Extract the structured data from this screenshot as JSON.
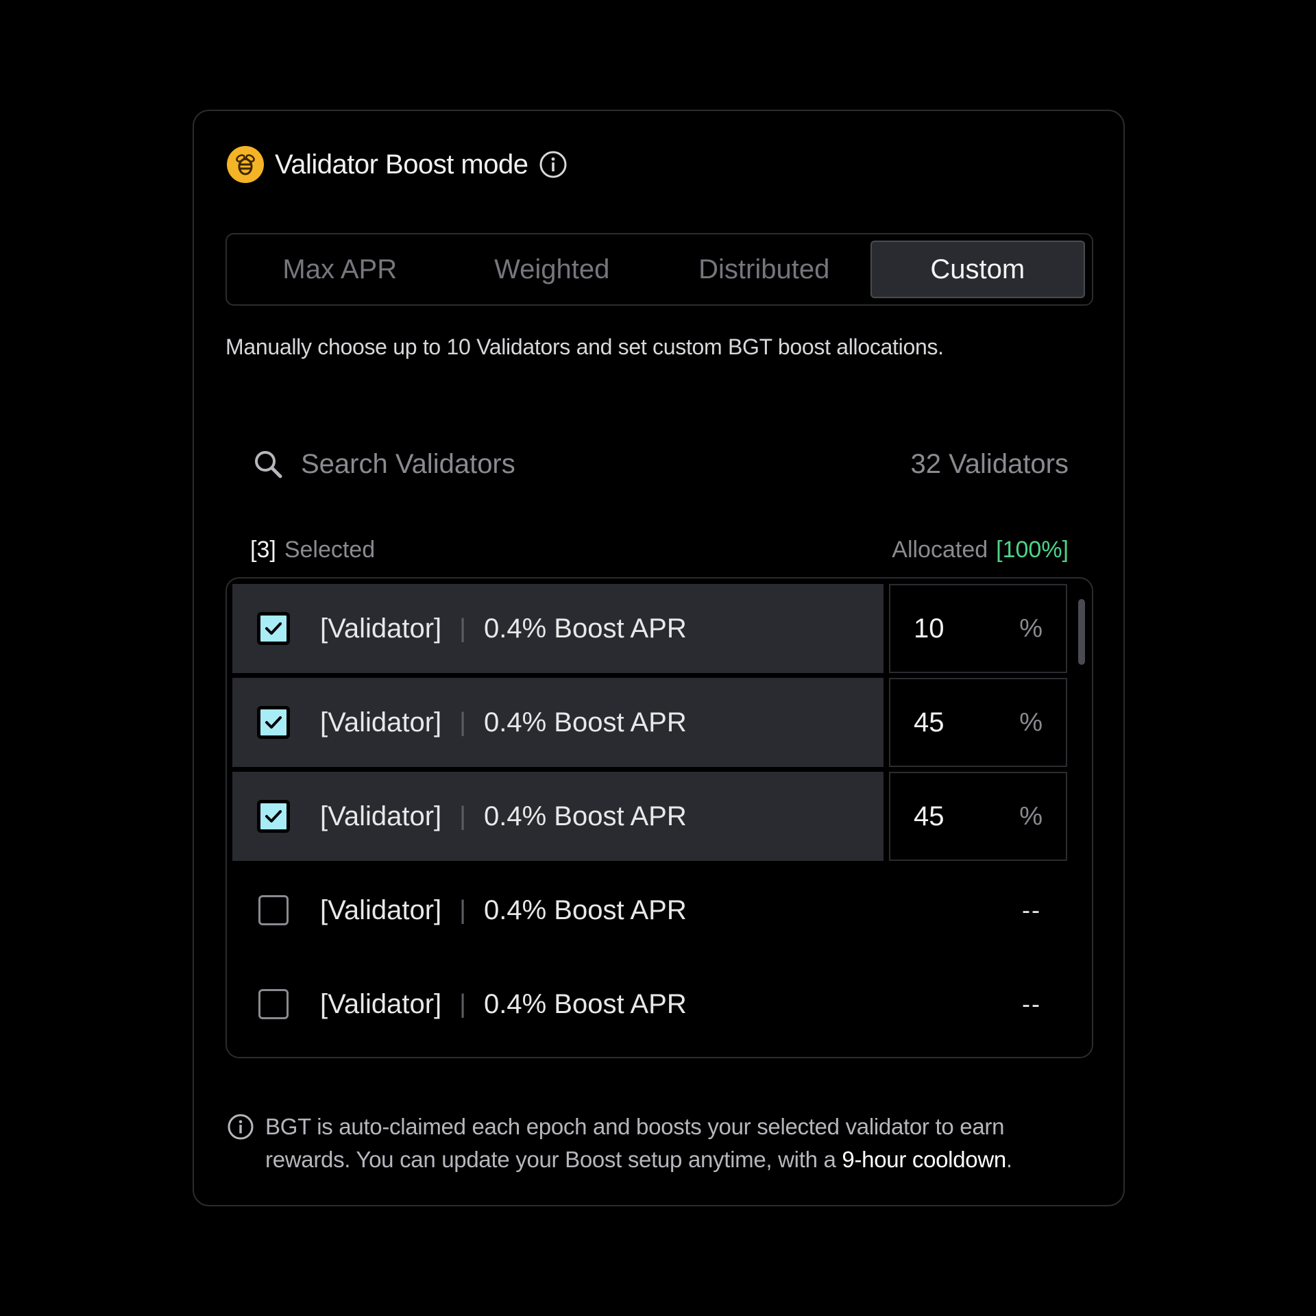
{
  "header": {
    "title": "Validator Boost mode",
    "logo_icon": "bee-logo-icon",
    "info_icon": "info-icon",
    "logo_color": "#f5b425"
  },
  "tabs": [
    {
      "label": "Max APR",
      "active": false
    },
    {
      "label": "Weighted",
      "active": false
    },
    {
      "label": "Distributed",
      "active": false
    },
    {
      "label": "Custom",
      "active": true
    }
  ],
  "description": "Manually choose up to 10 Validators and set custom BGT boost allocations.",
  "search": {
    "placeholder": "Search Validators",
    "value": "",
    "count_label": "32 Validators"
  },
  "summary": {
    "selected_count": "[3]",
    "selected_label": "Selected",
    "allocated_label": "Allocated",
    "allocated_value": "[100%]",
    "allocated_color": "#4ed48a"
  },
  "validators": [
    {
      "name": "[Validator]",
      "separator": "|",
      "apr": "0.4% Boost APR",
      "selected": true,
      "allocation": "10",
      "unit": "%"
    },
    {
      "name": "[Validator]",
      "separator": "|",
      "apr": "0.4% Boost APR",
      "selected": true,
      "allocation": "45",
      "unit": "%"
    },
    {
      "name": "[Validator]",
      "separator": "|",
      "apr": "0.4% Boost APR",
      "selected": true,
      "allocation": "45",
      "unit": "%"
    },
    {
      "name": "[Validator]",
      "separator": "|",
      "apr": "0.4% Boost APR",
      "selected": false,
      "allocation": "--"
    },
    {
      "name": "[Validator]",
      "separator": "|",
      "apr": "0.4% Boost APR",
      "selected": false,
      "allocation": "--"
    }
  ],
  "footer": {
    "text_main": "BGT is auto-claimed each epoch and boosts your selected validator to earn rewards. You can update your Boost setup anytime, with a ",
    "text_highlight": "9-hour cooldown",
    "text_end": "."
  },
  "colors": {
    "checkbox_checked": "#a8ecf6",
    "selected_row_bg": "#2a2b30"
  }
}
